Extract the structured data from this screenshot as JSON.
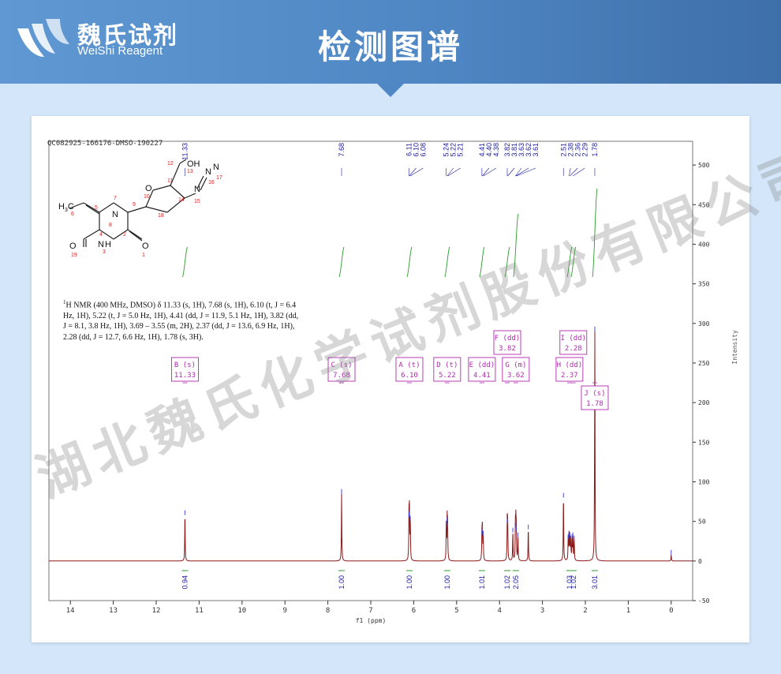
{
  "header": {
    "brand_cn": "魏氏试剂",
    "brand_en": "WeiShi Reagent",
    "title": "检测图谱"
  },
  "watermark": "湖北魏氏化学试剂股份有限公司",
  "sample_id": "QC082925-166176-DMSO-190227",
  "nmr_description": {
    "prefix": "H NMR (400 MHz, DMSO) δ 11.33 (s, 1H), 7.68 (s, 1H), 6.10 (t, J = 6.4 Hz, 1H), 5.22 (t, J = 5.0 Hz, 1H), 4.41 (dd, J = 11.9, 5.1 Hz, 1H), 3.82 (dd, J = 8.1, 3.8 Hz, 1H), 3.69 – 3.55 (m, 2H), 2.37 (dd, J = 13.6, 6.9 Hz, 1H), 2.28 (dd, J = 12.7, 6.6 Hz, 1H), 1.78 (s, 3H).",
    "isotope": "1"
  },
  "structure_labels": [
    {
      "text": "OH",
      "n": "13"
    },
    {
      "text": "12",
      "n": ""
    },
    {
      "text": "O",
      "n": "10"
    },
    {
      "text": "11",
      "n": ""
    },
    {
      "text": "N",
      "n": "16"
    },
    {
      "text": "N",
      "n": "15"
    }
  ],
  "colors": {
    "spectrum": "#8b1a1a",
    "integral": "#2a9a2a",
    "peak_label": "#1a1aa0",
    "multiplet_box": "#b02ab0",
    "header_bg": "#4f87c4",
    "page_bg": "#d3e6fa"
  },
  "chart_data": {
    "type": "line",
    "title": "",
    "xlabel": "f1 (ppm)",
    "ylabel": "Intensity",
    "xlim": [
      14.5,
      -0.5
    ],
    "ylim": [
      -50,
      530
    ],
    "x_ticks": [
      14,
      13,
      12,
      11,
      10,
      9,
      8,
      7,
      6,
      5,
      4,
      3,
      2,
      1,
      0
    ],
    "y_ticks": [
      -50,
      0,
      50,
      100,
      150,
      200,
      250,
      300,
      350,
      400,
      450,
      500
    ],
    "peak_labels_top": [
      "11.33",
      "7.68",
      "6.11",
      "6.10",
      "6.08",
      "5.24",
      "5.22",
      "5.21",
      "4.41",
      "4.40",
      "4.38",
      "3.82",
      "3.81",
      "3.63",
      "3.62",
      "3.61",
      "2.51",
      "2.38",
      "2.36",
      "2.29",
      "1.78"
    ],
    "peaks": [
      {
        "ppm": 11.33,
        "height": 58
      },
      {
        "ppm": 7.68,
        "height": 85
      },
      {
        "ppm": 6.11,
        "height": 55
      },
      {
        "ppm": 6.1,
        "height": 58
      },
      {
        "ppm": 6.08,
        "height": 50
      },
      {
        "ppm": 5.24,
        "height": 45
      },
      {
        "ppm": 5.22,
        "height": 49
      },
      {
        "ppm": 5.21,
        "height": 42
      },
      {
        "ppm": 4.41,
        "height": 34
      },
      {
        "ppm": 4.4,
        "height": 38
      },
      {
        "ppm": 4.38,
        "height": 32
      },
      {
        "ppm": 3.82,
        "height": 48
      },
      {
        "ppm": 3.81,
        "height": 46
      },
      {
        "ppm": 3.69,
        "height": 36
      },
      {
        "ppm": 3.63,
        "height": 42
      },
      {
        "ppm": 3.62,
        "height": 43
      },
      {
        "ppm": 3.61,
        "height": 38
      },
      {
        "ppm": 3.57,
        "height": 30
      },
      {
        "ppm": 3.33,
        "height": 40
      },
      {
        "ppm": 2.51,
        "height": 80
      },
      {
        "ppm": 2.4,
        "height": 28
      },
      {
        "ppm": 2.38,
        "height": 32
      },
      {
        "ppm": 2.36,
        "height": 30
      },
      {
        "ppm": 2.34,
        "height": 26
      },
      {
        "ppm": 2.31,
        "height": 28
      },
      {
        "ppm": 2.29,
        "height": 30
      },
      {
        "ppm": 2.26,
        "height": 26
      },
      {
        "ppm": 1.78,
        "height": 290
      },
      {
        "ppm": 0.0,
        "height": 8
      }
    ],
    "integrals": [
      {
        "ppm": 11.33,
        "value": "0.94"
      },
      {
        "ppm": 7.68,
        "value": "1.00"
      },
      {
        "ppm": 6.1,
        "value": "1.00"
      },
      {
        "ppm": 5.22,
        "value": "1.00"
      },
      {
        "ppm": 4.41,
        "value": "1.01"
      },
      {
        "ppm": 3.82,
        "value": "1.02"
      },
      {
        "ppm": 3.62,
        "value": "2.05"
      },
      {
        "ppm": 2.37,
        "value": "1.03"
      },
      {
        "ppm": 2.28,
        "value": "1.02"
      },
      {
        "ppm": 1.78,
        "value": "3.01"
      }
    ],
    "multiplets": [
      {
        "label": "B (s)",
        "shift": "11.33",
        "ppm": 11.33,
        "row": 1
      },
      {
        "label": "C (s)",
        "shift": "7.68",
        "ppm": 7.68,
        "row": 1
      },
      {
        "label": "A (t)",
        "shift": "6.10",
        "ppm": 6.1,
        "row": 1
      },
      {
        "label": "D (t)",
        "shift": "5.22",
        "ppm": 5.22,
        "row": 1
      },
      {
        "label": "E (dd)",
        "shift": "4.41",
        "ppm": 4.41,
        "row": 1
      },
      {
        "label": "F (dd)",
        "shift": "3.82",
        "ppm": 3.82,
        "row": 0
      },
      {
        "label": "G (m)",
        "shift": "3.62",
        "ppm": 3.62,
        "row": 1
      },
      {
        "label": "H (dd)",
        "shift": "2.37",
        "ppm": 2.37,
        "row": 1
      },
      {
        "label": "I (dd)",
        "shift": "2.28",
        "ppm": 2.28,
        "row": 0
      },
      {
        "label": "J (s)",
        "shift": "1.78",
        "ppm": 1.78,
        "row": 2
      }
    ]
  }
}
